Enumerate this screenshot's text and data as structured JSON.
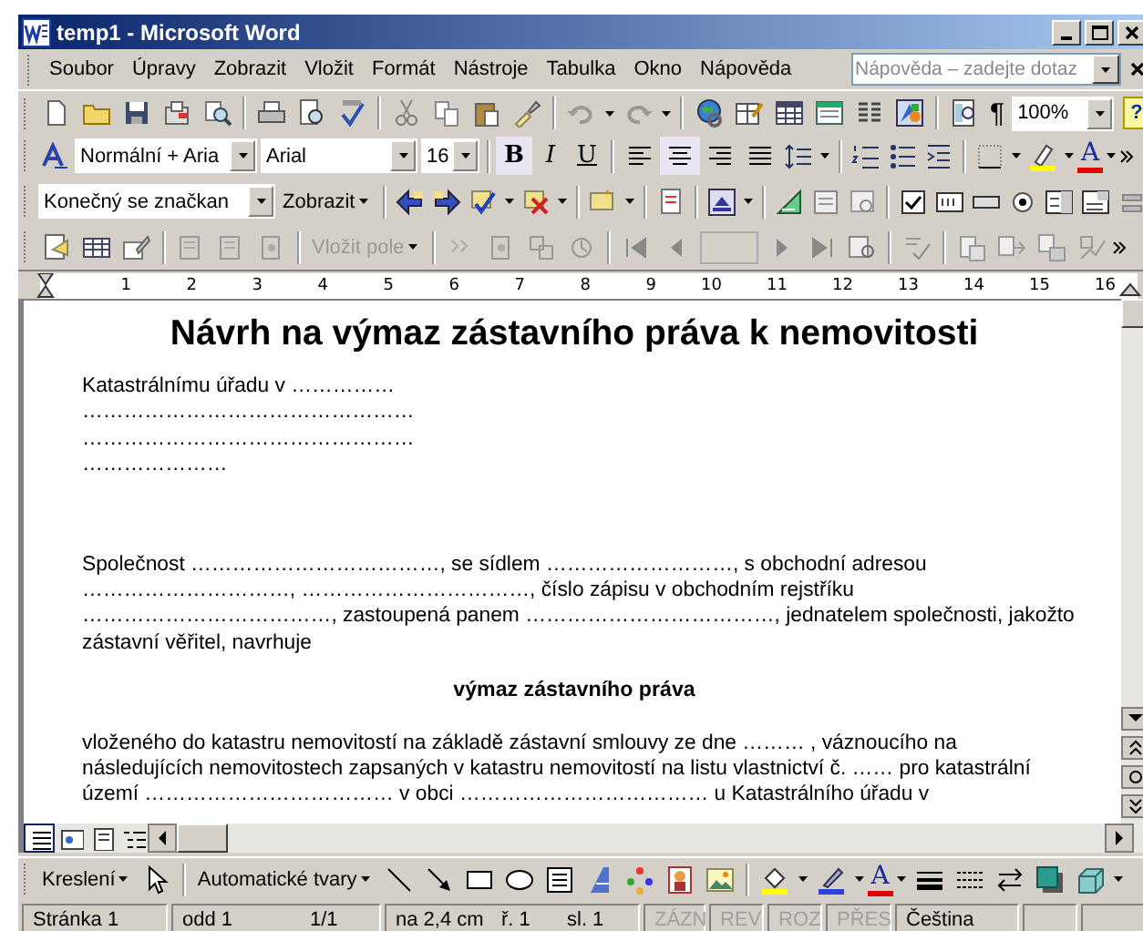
{
  "window": {
    "title": "temp1 - Microsoft Word"
  },
  "menu": [
    "Soubor",
    "Úpravy",
    "Zobrazit",
    "Vložit",
    "Formát",
    "Nástroje",
    "Tabulka",
    "Okno",
    "Nápověda"
  ],
  "help_box": {
    "placeholder": "Nápověda – zadejte dotaz"
  },
  "standard_toolbar": {
    "pilcrow": "¶",
    "zoom": "100%",
    "help_glyph": "?"
  },
  "formatting_toolbar": {
    "style": "Normální + Aria",
    "font": "Arial",
    "size": "16",
    "styles": [
      {
        "label": "B",
        "kind": "bold",
        "pressed": true
      },
      {
        "label": "I",
        "kind": "italic",
        "pressed": false
      },
      {
        "label": "U",
        "kind": "underline",
        "pressed": false
      }
    ],
    "alignment": [
      {
        "kind": "left",
        "pressed": false
      },
      {
        "kind": "center",
        "pressed": true
      },
      {
        "kind": "right",
        "pressed": false
      },
      {
        "kind": "justify",
        "pressed": false
      }
    ],
    "font_color_glyph": "A"
  },
  "reviewing_toolbar": {
    "display": "Konečný se značkan",
    "show_menu": "Zobrazit"
  },
  "mail_merge_toolbar": {
    "insert_field": {
      "label": "Vložit pole",
      "disabled": true
    }
  },
  "ruler": {
    "marks": [
      "1",
      "2",
      "3",
      "4",
      "5",
      "6",
      "7",
      "8",
      "9",
      "10",
      "11",
      "12",
      "13",
      "14",
      "15",
      "16"
    ]
  },
  "document": {
    "title": "Návrh na výmaz zástavního práva k nemovitosti",
    "blocks": [
      {
        "kind": "lines",
        "lines": [
          "Katastrálnímu úřadu v ……………",
          "…………………………………………",
          "…………………………………………",
          "…………………"
        ]
      },
      {
        "kind": "paragraph",
        "lines": [
          "Společnost ………………………………, se sídlem ………………………, s obchodní adresou",
          "…………………………, ……………………………, číslo zápisu v obchodním rejstříku",
          "………………………………, zastoupená panem ………………………………, jednatelem společnosti, jakožto",
          "zástavní věřitel, navrhuje"
        ]
      },
      {
        "kind": "heading",
        "lines": [
          "výmaz zástavního práva"
        ]
      },
      {
        "kind": "paragraph",
        "lines": [
          "vloženého do katastru nemovitostí na základě zástavní smlouvy ze dne ……… , váznoucího na",
          "následujících nemovitostech zapsaných v katastru nemovitostí na listu vlastnictví č. …… pro katastrální",
          "území ……………………………… v obci ……………………………… u Katastrálního úřadu v"
        ]
      }
    ]
  },
  "view_buttons": [
    {
      "selected": true
    },
    {
      "selected": false
    },
    {
      "selected": false
    },
    {
      "selected": false
    }
  ],
  "drawing_toolbar": {
    "draw_menu": "Kreslení",
    "autoshapes": "Automatické tvary",
    "font_color_glyph": "A"
  },
  "status_bar": {
    "page": "Stránka 1",
    "section": "odd 1",
    "pages": "1/1",
    "position": "na 2,4 cm",
    "line": "ř. 1",
    "column": "sl. 1",
    "modes": [
      {
        "label": "ZÁZN",
        "active": false
      },
      {
        "label": "REV",
        "active": false
      },
      {
        "label": "ROZ",
        "active": false
      },
      {
        "label": "PŘES",
        "active": false
      }
    ],
    "language": "Čeština"
  }
}
